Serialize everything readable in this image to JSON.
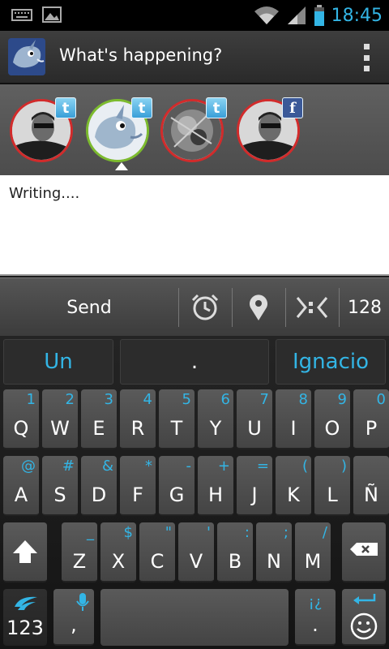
{
  "status": {
    "time": "18:45"
  },
  "actionbar": {
    "title": "What's happening?"
  },
  "accounts": [
    {
      "network": "twitter",
      "selected": false
    },
    {
      "network": "twitter",
      "selected": true
    },
    {
      "network": "twitter",
      "selected": false
    },
    {
      "network": "facebook",
      "selected": false
    }
  ],
  "badges": {
    "twitter": "t",
    "facebook": "f"
  },
  "compose": {
    "text": "Writing...."
  },
  "sendbar": {
    "send_label": "Send",
    "char_count": "128"
  },
  "keyboard": {
    "suggestions": [
      "Un",
      ".",
      "Ignacio"
    ],
    "row1": [
      {
        "k": "Q",
        "a": "1"
      },
      {
        "k": "W",
        "a": "2"
      },
      {
        "k": "E",
        "a": "3"
      },
      {
        "k": "R",
        "a": "4"
      },
      {
        "k": "T",
        "a": "5"
      },
      {
        "k": "Y",
        "a": "6"
      },
      {
        "k": "U",
        "a": "7"
      },
      {
        "k": "I",
        "a": "8"
      },
      {
        "k": "O",
        "a": "9"
      },
      {
        "k": "P",
        "a": "0"
      }
    ],
    "row2": [
      {
        "k": "A",
        "a": "@"
      },
      {
        "k": "S",
        "a": "#"
      },
      {
        "k": "D",
        "a": "&"
      },
      {
        "k": "F",
        "a": "*"
      },
      {
        "k": "G",
        "a": "-"
      },
      {
        "k": "H",
        "a": "+"
      },
      {
        "k": "J",
        "a": "="
      },
      {
        "k": "K",
        "a": "("
      },
      {
        "k": "L",
        "a": ")"
      },
      {
        "k": "Ñ",
        "a": ""
      }
    ],
    "row3": [
      {
        "k": "Z",
        "a": "_"
      },
      {
        "k": "X",
        "a": "$"
      },
      {
        "k": "C",
        "a": "\""
      },
      {
        "k": "V",
        "a": "'"
      },
      {
        "k": "B",
        "a": ":"
      },
      {
        "k": "N",
        "a": ";"
      },
      {
        "k": "M",
        "a": "/"
      }
    ],
    "numbers_label": "123",
    "comma": ",",
    "period": ".",
    "period_alt": "¡¿"
  },
  "colors": {
    "accent": "#33b5e5",
    "sel_red": "#d22b2b",
    "sel_green": "#7cbb2e"
  }
}
